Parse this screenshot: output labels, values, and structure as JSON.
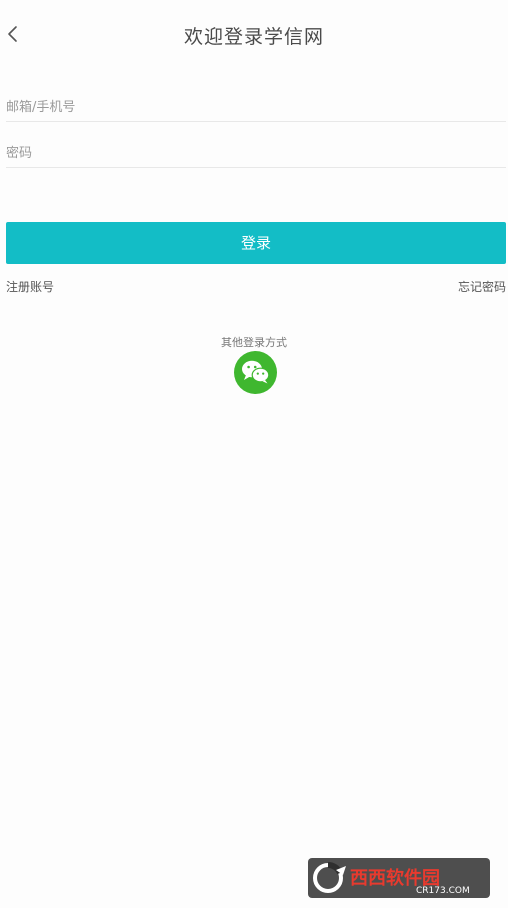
{
  "header": {
    "title": "欢迎登录学信网",
    "back_icon": "chevron-left-icon"
  },
  "form": {
    "email_placeholder": "邮箱/手机号",
    "password_placeholder": "密码",
    "login_label": "登录"
  },
  "links": {
    "register_label": "注册账号",
    "forgot_label": "忘记密码"
  },
  "other_login": {
    "label": "其他登录方式",
    "wechat_icon": "wechat-icon"
  },
  "watermark": {
    "text": "西西软件园",
    "subtext": "CR173.COM"
  },
  "colors": {
    "accent": "#13bdc6",
    "wechat": "#3fb72f",
    "background": "#fdfdfd"
  }
}
